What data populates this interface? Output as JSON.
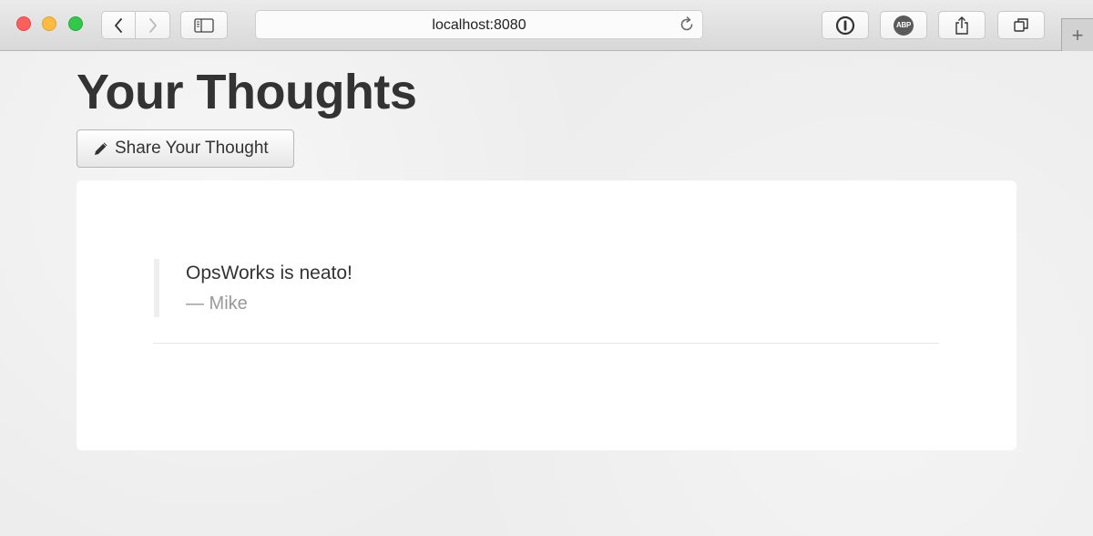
{
  "browser": {
    "url": "localhost:8080",
    "icons": {
      "back": "chevron-left-icon",
      "forward": "chevron-right-icon",
      "sidebar": "sidebar-icon",
      "reload": "reload-icon",
      "password_manager": "1password-icon",
      "adblock": "abp-icon",
      "share": "share-icon",
      "tabs": "tabs-icon",
      "new_tab": "plus-icon"
    },
    "adblock_label": "ABP",
    "new_tab_label": "+"
  },
  "page": {
    "title": "Your Thoughts",
    "share_button_label": "Share Your Thought",
    "thoughts": [
      {
        "text": "OpsWorks is neato!",
        "author": "— Mike"
      }
    ]
  },
  "colors": {
    "close": "#fc605c",
    "minimize": "#fdbc40",
    "maximize": "#34c84a",
    "title_text": "#333333",
    "author_text": "#999999"
  }
}
